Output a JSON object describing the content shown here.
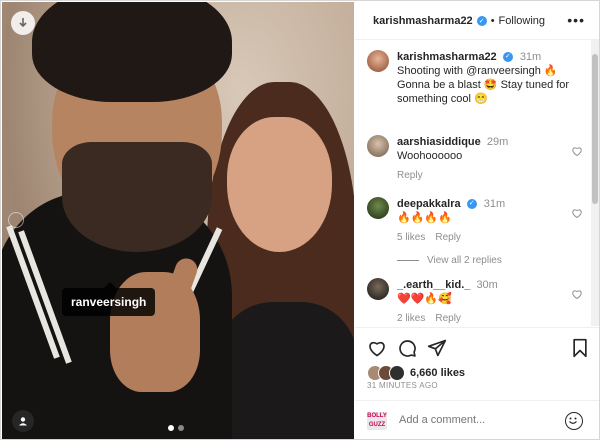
{
  "post": {
    "author": "karishmasharma22",
    "following_label": "Following",
    "sep": "•",
    "photo_tag": "ranveersingh"
  },
  "caption": {
    "user": "karishmasharma22",
    "time": "31m",
    "text": "Shooting with @ranveersingh 🔥 Gonna be a blast 🤩 Stay tuned for something cool 😁"
  },
  "comments": [
    {
      "user": "aarshiasiddique",
      "time": "29m",
      "text": "Woohoooooo",
      "reply": "Reply",
      "likes": ""
    },
    {
      "user": "deepakkalra",
      "time": "31m",
      "text": "🔥🔥🔥🔥",
      "likes": "5 likes",
      "reply": "Reply",
      "view_replies": "View all 2 replies"
    },
    {
      "user": "_.earth__kid._",
      "time": "30m",
      "text": "❤️❤️🔥🥰",
      "likes": "2 likes",
      "reply": "Reply"
    }
  ],
  "likes_count": "6,660 likes",
  "time_ago": "31 MINUTES AGO",
  "comment_placeholder": "Add a comment...",
  "logo_text": "BOLLY GUZZ",
  "icons": [
    "download-icon",
    "heart-icon",
    "comment-icon",
    "share-icon",
    "bookmark-icon",
    "emoji-icon",
    "more-icon",
    "user-tag-icon"
  ],
  "colors": {
    "verified": "#3897f0",
    "muted": "#8e8e8e",
    "text": "#262626"
  }
}
